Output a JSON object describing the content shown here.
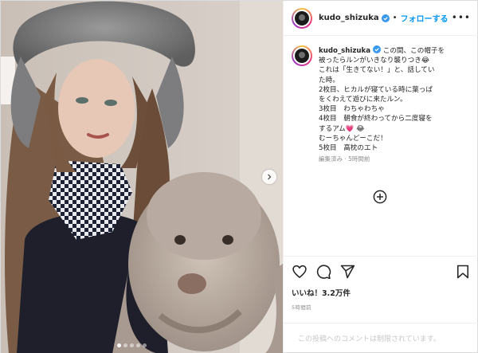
{
  "post": {
    "username": "kudo_shizuka",
    "follow_label": "フォローする",
    "separator": "•",
    "more_label": "•••"
  },
  "caption": {
    "username": "kudo_shizuka",
    "first": "この間、この帽子を",
    "lines": [
      "被ったらルンがいきなり襲りつき😂",
      "これは「生きてない！」と、話してい",
      "た時。",
      "2枚目、ヒカルが寝ている時に葉っぱ",
      "をくわえて遊びに来たルン。",
      "3枚目　わちゃわちゃ",
      "4枚目　朝食が終わってから二度寝を",
      "するアム💗 😂",
      "むーちゃんどーこだ！",
      "5枚目　高枕のエト"
    ],
    "meta": "編集済み · 5時間前"
  },
  "engagement": {
    "likes": "いいね！3.2万件",
    "age": "5時間前"
  },
  "comments": {
    "restricted": "この投稿へのコメントは制限されています。"
  },
  "carousel": {
    "total": 5,
    "current": 1
  },
  "colors": {
    "accent": "#0095f6",
    "verified": "#3897f0",
    "text": "#262626",
    "muted": "#8e8e8e"
  },
  "icons": {
    "like": "heart-icon",
    "comment": "comment-icon",
    "share": "paper-plane-icon",
    "save": "bookmark-icon",
    "add": "plus-circle-icon",
    "next": "chevron-right-icon",
    "verified": "verified-badge-icon",
    "more": "ellipsis-icon"
  }
}
